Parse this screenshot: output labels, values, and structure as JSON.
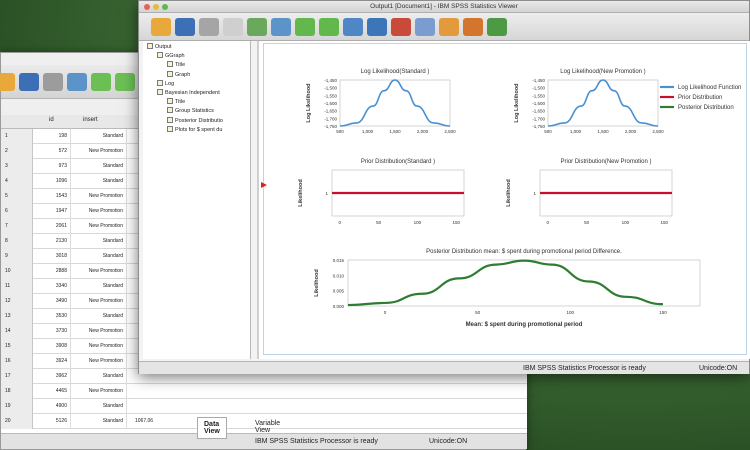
{
  "viewer": {
    "title": "Output1 [Document1] - IBM SPSS Statistics Viewer",
    "status_text": "IBM SPSS Statistics Processor is ready",
    "encoding": "Unicode:ON",
    "outline": [
      {
        "label": "Output",
        "level": 0
      },
      {
        "label": "GGraph",
        "level": 1
      },
      {
        "label": "Title",
        "level": 2
      },
      {
        "label": "Graph",
        "level": 2
      },
      {
        "label": "Log",
        "level": 1
      },
      {
        "label": "Bayesian Independent",
        "level": 1
      },
      {
        "label": "Title",
        "level": 2
      },
      {
        "label": "Group Statistics",
        "level": 2
      },
      {
        "label": "Posterior Distributio",
        "level": 2
      },
      {
        "label": "Plots for $ spent du",
        "level": 2
      }
    ]
  },
  "editor": {
    "col_id": "id",
    "col_insert": "insert",
    "rows": [
      {
        "n": "1",
        "id": "198",
        "insert": "Standard"
      },
      {
        "n": "2",
        "id": "572",
        "insert": "New Promotion"
      },
      {
        "n": "3",
        "id": "973",
        "insert": "Standard"
      },
      {
        "n": "4",
        "id": "1096",
        "insert": "Standard"
      },
      {
        "n": "5",
        "id": "1543",
        "insert": "New Promotion"
      },
      {
        "n": "6",
        "id": "1947",
        "insert": "New Promotion"
      },
      {
        "n": "7",
        "id": "2061",
        "insert": "New Promotion"
      },
      {
        "n": "8",
        "id": "2130",
        "insert": "Standard"
      },
      {
        "n": "9",
        "id": "3018",
        "insert": "Standard"
      },
      {
        "n": "10",
        "id": "2888",
        "insert": "New Promotion"
      },
      {
        "n": "11",
        "id": "3340",
        "insert": "Standard"
      },
      {
        "n": "12",
        "id": "3490",
        "insert": "New Promotion"
      },
      {
        "n": "13",
        "id": "3530",
        "insert": "Standard"
      },
      {
        "n": "14",
        "id": "3730",
        "insert": "New Promotion"
      },
      {
        "n": "15",
        "id": "3908",
        "insert": "New Promotion"
      },
      {
        "n": "16",
        "id": "3924",
        "insert": "New Promotion"
      },
      {
        "n": "17",
        "id": "3962",
        "insert": "Standard"
      },
      {
        "n": "18",
        "id": "4465",
        "insert": "New Promotion"
      },
      {
        "n": "19",
        "id": "4900",
        "insert": "Standard"
      },
      {
        "n": "20",
        "id": "5126",
        "insert": "Standard"
      }
    ],
    "cell_value_row20": "1067.06",
    "tab_data_view": "Data View",
    "tab_variable_view": "Variable View",
    "status_text": "IBM SPSS Statistics Processor is ready",
    "encoding": "Unicode:ON"
  },
  "chart_data": [
    {
      "type": "line",
      "title": "Log Likelihood(Standard )",
      "ylabel": "Log Likelihood",
      "x_ticks": [
        "500",
        "1,000",
        "1,500",
        "2,000",
        "2,500"
      ],
      "y_ticks": [
        "-1,450",
        "-1,500",
        "-1,550",
        "-1,600",
        "-1,650",
        "-1,700",
        "-1,750"
      ],
      "series": [
        {
          "name": "Log Likelihood Function",
          "color": "#4a90d0",
          "x": [
            500,
            800,
            1100,
            1300,
            1500,
            1700,
            1900,
            2200,
            2500
          ],
          "y": [
            -1750,
            -1730,
            -1620,
            -1520,
            -1450,
            -1520,
            -1620,
            -1730,
            -1750
          ]
        }
      ]
    },
    {
      "type": "line",
      "title": "Log Likelihood(New Promotion )",
      "ylabel": "Log Likelihood",
      "x_ticks": [
        "500",
        "1,000",
        "1,500",
        "2,000",
        "2,500"
      ],
      "y_ticks": [
        "-1,450",
        "-1,500",
        "-1,550",
        "-1,600",
        "-1,650",
        "-1,700",
        "-1,750"
      ],
      "series": [
        {
          "name": "Log Likelihood Function",
          "color": "#4a90d0",
          "x": [
            500,
            800,
            1100,
            1300,
            1500,
            1700,
            1900,
            2200,
            2500
          ],
          "y": [
            -1750,
            -1730,
            -1620,
            -1520,
            -1450,
            -1520,
            -1620,
            -1730,
            -1750
          ]
        }
      ]
    },
    {
      "type": "line",
      "title": "Prior Distribution(Standard )",
      "ylabel": "Likelihood",
      "x_ticks": [
        "0",
        "50",
        "100",
        "150"
      ],
      "y_ticks": [
        "1"
      ],
      "series": [
        {
          "name": "Prior Distribution",
          "color": "#c8102e",
          "x": [
            -10,
            160
          ],
          "y": [
            1,
            1
          ]
        }
      ]
    },
    {
      "type": "line",
      "title": "Prior Distribution(New Promotion )",
      "ylabel": "Likelihood",
      "x_ticks": [
        "0",
        "50",
        "100",
        "150"
      ],
      "y_ticks": [
        "1"
      ],
      "series": [
        {
          "name": "Prior Distribution",
          "color": "#c8102e",
          "x": [
            -10,
            160
          ],
          "y": [
            1,
            1
          ]
        }
      ]
    },
    {
      "type": "area",
      "title": "Posterior Distribution mean: $ spent during promotional period Difference.",
      "xlabel": "Mean: $ spent during promotional period",
      "ylabel": "Likelihood",
      "x_ticks": [
        "0",
        "50",
        "100",
        "150"
      ],
      "y_ticks": [
        "0.015",
        "0.010",
        "0.005",
        "0.000"
      ],
      "series": [
        {
          "name": "Posterior Distribution",
          "color": "#2e7d32",
          "x": [
            -20,
            0,
            20,
            40,
            60,
            75,
            90,
            110,
            130,
            150
          ],
          "y": [
            0.0003,
            0.001,
            0.004,
            0.009,
            0.0135,
            0.0148,
            0.0135,
            0.008,
            0.003,
            0.0006
          ]
        }
      ]
    }
  ],
  "legend": [
    {
      "label": "Log Likelihood Function",
      "color": "#4a90d0"
    },
    {
      "label": "Prior Distribution",
      "color": "#c8102e"
    },
    {
      "label": "Posterior Distribution",
      "color": "#2e7d32"
    }
  ]
}
